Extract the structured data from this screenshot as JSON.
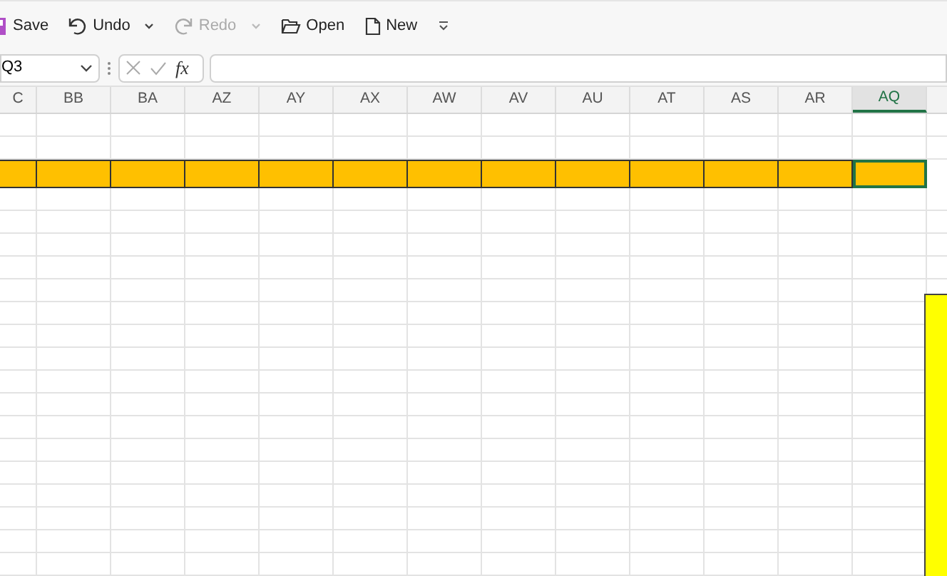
{
  "toolbar": [
    {
      "kind": "save",
      "label": "Save",
      "disabled": false,
      "dropdown": false
    },
    {
      "kind": "undo",
      "label": "Undo",
      "disabled": false,
      "dropdown": true
    },
    {
      "kind": "redo",
      "label": "Redo",
      "disabled": true,
      "dropdown": true
    },
    {
      "kind": "open",
      "label": "Open",
      "disabled": false,
      "dropdown": false
    },
    {
      "kind": "new",
      "label": "New",
      "disabled": false,
      "dropdown": false
    }
  ],
  "name_box": {
    "value": "Q3"
  },
  "formula_bar": {
    "function_symbol": "fx"
  },
  "columns": [
    {
      "label": "C",
      "selected": false
    },
    {
      "label": "BB",
      "selected": false
    },
    {
      "label": "BA",
      "selected": false
    },
    {
      "label": "AZ",
      "selected": false
    },
    {
      "label": "AY",
      "selected": false
    },
    {
      "label": "AX",
      "selected": false
    },
    {
      "label": "AW",
      "selected": false
    },
    {
      "label": "AV",
      "selected": false
    },
    {
      "label": "AU",
      "selected": false
    },
    {
      "label": "AT",
      "selected": false
    },
    {
      "label": "AS",
      "selected": false
    },
    {
      "label": "AR",
      "selected": false
    },
    {
      "label": "AQ",
      "selected": true
    }
  ],
  "rows": [
    {
      "highlighted": false
    },
    {
      "highlighted": false
    },
    {
      "highlighted": true
    },
    {
      "highlighted": false
    },
    {
      "highlighted": false
    },
    {
      "highlighted": false
    },
    {
      "highlighted": false
    },
    {
      "highlighted": false
    },
    {
      "highlighted": false
    },
    {
      "highlighted": false
    },
    {
      "highlighted": false
    },
    {
      "highlighted": false
    },
    {
      "highlighted": false
    },
    {
      "highlighted": false
    },
    {
      "highlighted": false
    },
    {
      "highlighted": false
    },
    {
      "highlighted": false
    },
    {
      "highlighted": false
    },
    {
      "highlighted": false
    },
    {
      "highlighted": false
    }
  ]
}
